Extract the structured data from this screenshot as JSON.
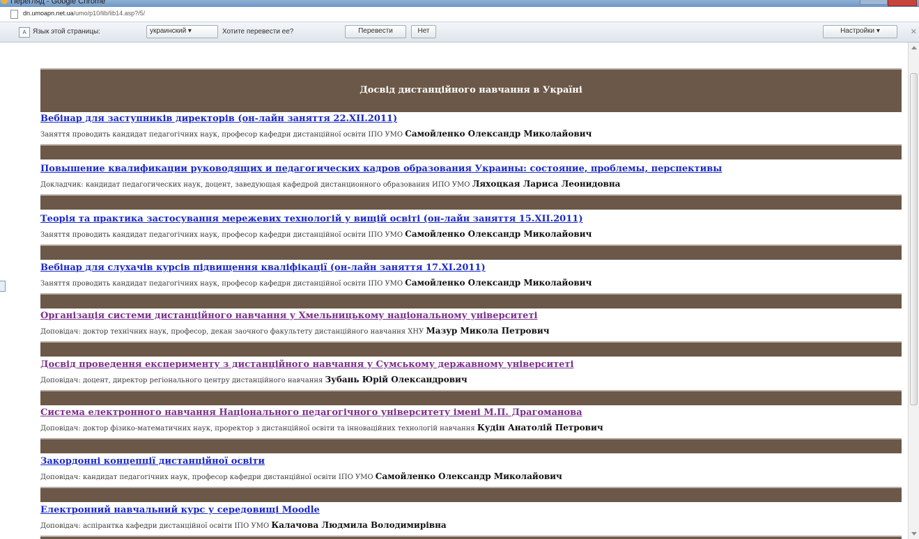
{
  "window": {
    "title": "Перегляд - Google Chrome"
  },
  "address": {
    "domain": "dn.umoapn.net.ua",
    "path": "/umo/p10/lib/lib14.asp?/5/"
  },
  "translate_bar": {
    "prompt": "Язык этой страницы:",
    "language": "украинский ▾",
    "question": "Хотите перевести ее?",
    "translate_label": "Перевести",
    "no_label": "Нет",
    "settings_label": "Настройки ▾",
    "close_glyph": "✕",
    "icon_glyph": "A"
  },
  "page": {
    "header": "Досвід дистанційного навчання в Україні",
    "entries": [
      {
        "title": "Вебінар для заступників директорів (он-лайн заняття 22.XII.2011)",
        "desc": "Заняття проводить кандидат педагогічних наук, професор кафедри дистанційної освіти ІПО УМО ",
        "name": "Самойленко Олександр Миколайович",
        "state": "link"
      },
      {
        "title": "Повышение квалификации руководящих и педагогических кадров образования Украины: состояние, проблемы, перспективы",
        "desc": "Докладчик: кандидат педагогических наук, доцент, заведующая кафедрой дистанционного образования ИПО УМО ",
        "name": "Ляхоцкая Лариса Леонидовна",
        "state": "link"
      },
      {
        "title": "Теорія та практика застосування мережевих технологій у вищій освіті (он-лайн заняття 15.XII.2011)",
        "desc": "Заняття проводить кандидат педагогічних наук, професор кафедри дистанційної освіти ІПО УМО ",
        "name": "Самойленко Олександр Миколайович",
        "state": "link"
      },
      {
        "title": "Вебінар для слухачів курсів підвищення кваліфікації (он-лайн заняття 17.XI.2011)",
        "desc": "Заняття проводить кандидат педагогічних наук, професор кафедри дистанційної освіти ІПО УМО ",
        "name": "Самойленко Олександр Миколайович",
        "state": "link"
      },
      {
        "title": "Організація системи дистанційного навчання у Хмельницькому національному університеті",
        "desc": "Доповідач: доктор технічних наук, професор, декан заочного факультету дистанційного навчання ХНУ ",
        "name": "Мазур Микола Петрович",
        "state": "visited"
      },
      {
        "title": "Досвід проведення експерименту з дистанційного навчання у Сумському державному університеті",
        "desc": "Доповідач: доцент, директор регіонального центру дистанційного навчання ",
        "name": "Зубань Юрій Олександрович",
        "state": "visited"
      },
      {
        "title": "Система електронного навчання Національного педагогічного університету імені М.П. Драгоманова",
        "desc": "Доповідач: доктор фізико-математичних наук, проректор з дистанційної освіти та інноваційних технологій навчання ",
        "name": "Кудін Анатолій Петрович",
        "state": "visited"
      },
      {
        "title": "Закордонні концепції дистанційної освіти",
        "desc": "Доповідач: кандидат педагогічних наук, професор кафедри дистанційної освіти ІПО УМО ",
        "name": "Самойленко Олександр Миколайович",
        "state": "link"
      },
      {
        "title": "Електронний навчальний курс у середовищі Moodle",
        "desc": "Доповідач: аспірантка кафедри дистанційної освіти ІПО УМО ",
        "name": "Калачова Людмила Володимирівна",
        "state": "link"
      }
    ]
  },
  "colors": {
    "brown_bar": "#6b5848",
    "link": "#1a29c8",
    "visited": "#7a2f8c"
  }
}
